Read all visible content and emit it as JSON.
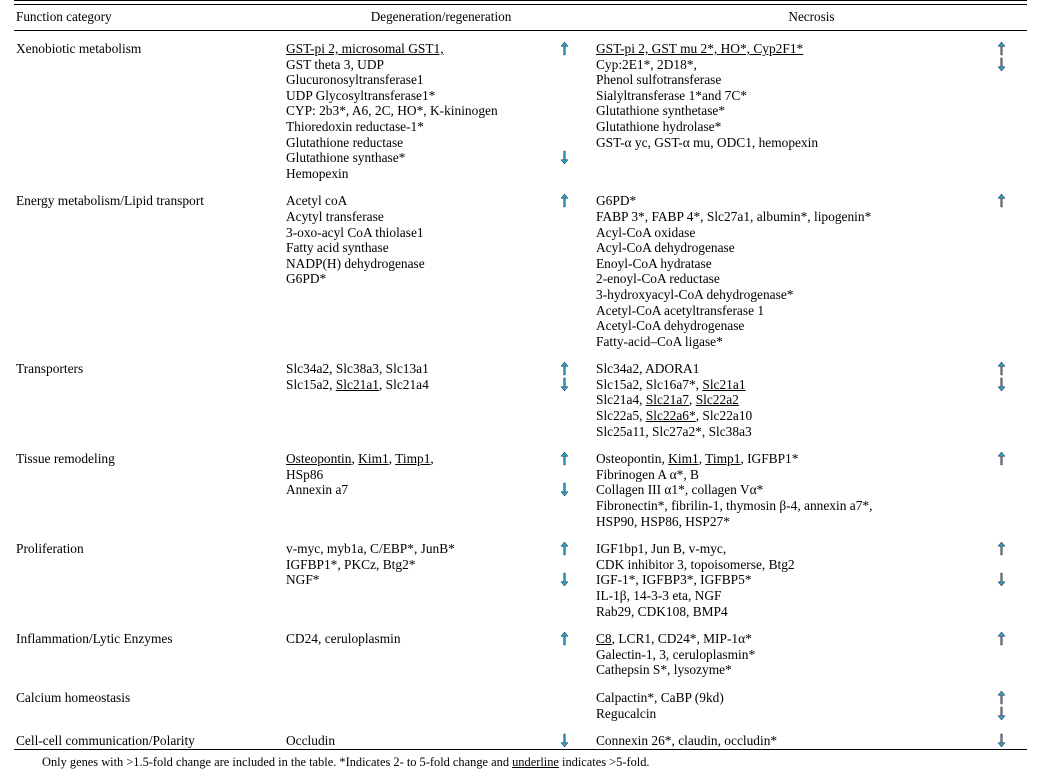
{
  "table": {
    "headers": {
      "category": "Function category",
      "degeneration": "Degeneration/regeneration",
      "necrosis": "Necrosis"
    },
    "footnote": "Only genes with >1.5-fold change are included in the table. *Indicates 2- to 5-fold change and underline indicates >5-fold.",
    "footnote_parts": {
      "a": "Only genes with >1.5-fold change are included in the table. *Indicates 2- to 5-fold change and ",
      "b": "underline",
      "c": " indicates >5-fold."
    },
    "arrow_color": "#2f9fbf",
    "rows": [
      {
        "category": "Xenobiotic metabolism",
        "degeneration_lines": [
          [
            {
              "t": "GST-pi 2, microsomal GST1,",
              "u": true
            }
          ],
          [
            {
              "t": "GST theta 3, UDP",
              "u": false
            }
          ],
          [
            {
              "t": "Glucuronosyltransferase1",
              "u": false
            }
          ],
          [
            {
              "t": "UDP Glycosyltransferase1*",
              "u": false
            }
          ],
          [
            {
              "t": "CYP: 2b3*, A6, 2C, HO*, K-kininogen",
              "u": false
            }
          ],
          [
            {
              "t": "Thioredoxin reductase-1*",
              "u": false
            }
          ],
          [
            {
              "t": "Glutathione reductase",
              "u": false
            }
          ],
          [
            {
              "t": "Glutathione synthase*",
              "u": false
            }
          ],
          [
            {
              "t": "Hemopexin",
              "u": false
            }
          ]
        ],
        "degeneration_arrows": [
          {
            "line": 0,
            "dir": "up"
          },
          {
            "line": 7,
            "dir": "down"
          }
        ],
        "necrosis_lines": [
          [
            {
              "t": "GST-pi 2, GST mu 2*, HO*, Cyp2F1*",
              "u": true
            }
          ],
          [
            {
              "t": "Cyp:2E1*, 2D18*,",
              "u": false
            }
          ],
          [
            {
              "t": "Phenol sulfotransferase",
              "u": false
            }
          ],
          [
            {
              "t": "Sialyltransferase 1*and 7C*",
              "u": false
            }
          ],
          [
            {
              "t": "Glutathione synthetase*",
              "u": false
            }
          ],
          [
            {
              "t": "Glutathione hydrolase*",
              "u": false
            }
          ],
          [
            {
              "t": "GST-α yc, GST-α mu, ODC1, hemopexin",
              "u": false
            }
          ]
        ],
        "necrosis_arrows": [
          {
            "line": 0,
            "dir": "up"
          },
          {
            "line": 1,
            "dir": "down"
          }
        ]
      },
      {
        "category": "Energy metabolism/Lipid transport",
        "degeneration_lines": [
          [
            {
              "t": "Acetyl coA",
              "u": false
            }
          ],
          [
            {
              "t": "Acytyl transferase",
              "u": false
            }
          ],
          [
            {
              "t": "3-oxo-acyl CoA thiolase1",
              "u": false
            }
          ],
          [
            {
              "t": "Fatty acid synthase",
              "u": false
            }
          ],
          [
            {
              "t": "NADP(H) dehydrogenase",
              "u": false
            }
          ],
          [
            {
              "t": "G6PD*",
              "u": false
            }
          ]
        ],
        "degeneration_arrows": [
          {
            "line": 0,
            "dir": "up"
          }
        ],
        "necrosis_lines": [
          [
            {
              "t": "G6PD*",
              "u": false
            }
          ],
          [
            {
              "t": "FABP 3*, FABP 4*, Slc27a1, albumin*, lipogenin*",
              "u": false
            }
          ],
          [
            {
              "t": "Acyl-CoA oxidase",
              "u": false
            }
          ],
          [
            {
              "t": "Acyl-CoA dehydrogenase",
              "u": false
            }
          ],
          [
            {
              "t": "Enoyl-CoA hydratase",
              "u": false
            }
          ],
          [
            {
              "t": "2-enoyl-CoA reductase",
              "u": false
            }
          ],
          [
            {
              "t": "3-hydroxyacyl-CoA dehydrogenase*",
              "u": false
            }
          ],
          [
            {
              "t": "Acetyl-CoA acetyltransferase 1",
              "u": false
            }
          ],
          [
            {
              "t": "Acetyl-CoA dehydrogenase",
              "u": false
            }
          ],
          [
            {
              "t": "Fatty-acid–CoA ligase*",
              "u": false
            }
          ]
        ],
        "necrosis_arrows": [
          {
            "line": 0,
            "dir": "up"
          }
        ]
      },
      {
        "category": "Transporters",
        "degeneration_lines": [
          [
            {
              "t": "Slc34a2, Slc38a3, Slc13a1",
              "u": false
            }
          ],
          [
            {
              "t": "Slc15a2, ",
              "u": false
            },
            {
              "t": "Slc21a1",
              "u": true
            },
            {
              "t": ", Slc21a4",
              "u": false
            }
          ]
        ],
        "degeneration_arrows": [
          {
            "line": 0,
            "dir": "up"
          },
          {
            "line": 1,
            "dir": "down"
          }
        ],
        "necrosis_lines": [
          [
            {
              "t": "Slc34a2, ADORA1",
              "u": false
            }
          ],
          [
            {
              "t": "Slc15a2, Slc16a7*, ",
              "u": false
            },
            {
              "t": "Slc21a1",
              "u": true
            }
          ],
          [
            {
              "t": "Slc21a4, ",
              "u": false
            },
            {
              "t": "Slc21a7",
              "u": true
            },
            {
              "t": ", ",
              "u": false
            },
            {
              "t": "Slc22a2",
              "u": true
            }
          ],
          [
            {
              "t": "Slc22a5, ",
              "u": false
            },
            {
              "t": "Slc22a6*",
              "u": true
            },
            {
              "t": ", Slc22a10",
              "u": false
            }
          ],
          [
            {
              "t": "Slc25a11, Slc27a2*, Slc38a3",
              "u": false
            }
          ]
        ],
        "necrosis_arrows": [
          {
            "line": 0,
            "dir": "up"
          },
          {
            "line": 1,
            "dir": "down"
          }
        ]
      },
      {
        "category": "Tissue remodeling",
        "degeneration_lines": [
          [
            {
              "t": "Osteopontin",
              "u": true
            },
            {
              "t": ", ",
              "u": false
            },
            {
              "t": "Kim1",
              "u": true
            },
            {
              "t": ", ",
              "u": false
            },
            {
              "t": "Timp1",
              "u": true
            },
            {
              "t": ",",
              "u": false
            }
          ],
          [
            {
              "t": "HSp86",
              "u": false
            }
          ],
          [
            {
              "t": "Annexin a7",
              "u": false
            }
          ]
        ],
        "degeneration_arrows": [
          {
            "line": 0,
            "dir": "up"
          },
          {
            "line": 2,
            "dir": "down"
          }
        ],
        "necrosis_lines": [
          [
            {
              "t": "Osteopontin",
              "u": false
            },
            {
              "t": ", ",
              "u": false
            },
            {
              "t": "Kim1",
              "u": true
            },
            {
              "t": ", ",
              "u": false
            },
            {
              "t": "Timp1",
              "u": true
            },
            {
              "t": ", IGFBP1*",
              "u": false
            }
          ],
          [
            {
              "t": "Fibrinogen A α*, B",
              "u": false
            }
          ],
          [
            {
              "t": "Collagen III α1*, collagen Vα*",
              "u": false
            }
          ],
          [
            {
              "t": "Fibronectin*, fibrilin-1, thymosin β-4, annexin a7*,",
              "u": false
            }
          ],
          [
            {
              "t": "HSP90, HSP86, HSP27*",
              "u": false
            }
          ]
        ],
        "necrosis_arrows": [
          {
            "line": 0,
            "dir": "up"
          }
        ]
      },
      {
        "category": "Proliferation",
        "degeneration_lines": [
          [
            {
              "t": "v-myc, myb1a, C/EBP*, JunB*",
              "u": false
            }
          ],
          [
            {
              "t": "IGFBP1*, PKCz, Btg2*",
              "u": false
            }
          ],
          [
            {
              "t": "NGF*",
              "u": false
            }
          ]
        ],
        "degeneration_arrows": [
          {
            "line": 0,
            "dir": "up"
          },
          {
            "line": 2,
            "dir": "down"
          }
        ],
        "necrosis_lines": [
          [
            {
              "t": "IGF1bp1, Jun B, v-myc,",
              "u": false
            }
          ],
          [
            {
              "t": "CDK inhibitor 3, topoisomerse, Btg2",
              "u": false
            }
          ],
          [
            {
              "t": "IGF-1*, IGFBP3*, IGFBP5*",
              "u": false
            }
          ],
          [
            {
              "t": "IL-1β, 14-3-3 eta, NGF",
              "u": false
            }
          ],
          [
            {
              "t": "Rab29, CDK108, BMP4",
              "u": false
            }
          ]
        ],
        "necrosis_arrows": [
          {
            "line": 0,
            "dir": "up"
          },
          {
            "line": 2,
            "dir": "down"
          }
        ]
      },
      {
        "category": "Inflammation/Lytic Enzymes",
        "degeneration_lines": [
          [
            {
              "t": "CD24, ceruloplasmin",
              "u": false
            }
          ]
        ],
        "degeneration_arrows": [
          {
            "line": 0,
            "dir": "up"
          }
        ],
        "necrosis_lines": [
          [
            {
              "t": "C8",
              "u": true
            },
            {
              "t": ", LCR1, CD24*, MIP-1α*",
              "u": false
            }
          ],
          [
            {
              "t": "Galectin-1, 3, ceruloplasmin*",
              "u": false
            }
          ],
          [
            {
              "t": "Cathepsin S*, lysozyme*",
              "u": false
            }
          ]
        ],
        "necrosis_arrows": [
          {
            "line": 0,
            "dir": "up"
          }
        ]
      },
      {
        "category": "Calcium homeostasis",
        "degeneration_lines": [],
        "degeneration_arrows": [],
        "necrosis_lines": [
          [
            {
              "t": "Calpactin*, CaBP (9kd)",
              "u": false
            }
          ],
          [
            {
              "t": "Regucalcin",
              "u": false
            }
          ]
        ],
        "necrosis_arrows": [
          {
            "line": 0,
            "dir": "up"
          },
          {
            "line": 1,
            "dir": "down"
          }
        ]
      },
      {
        "category": "Cell-cell communication/Polarity",
        "degeneration_lines": [
          [
            {
              "t": "Occludin",
              "u": false
            }
          ]
        ],
        "degeneration_arrows": [
          {
            "line": 0,
            "dir": "down"
          }
        ],
        "necrosis_lines": [
          [
            {
              "t": "Connexin 26*, claudin, occludin*",
              "u": false
            }
          ]
        ],
        "necrosis_arrows": [
          {
            "line": 0,
            "dir": "down"
          }
        ]
      }
    ]
  }
}
